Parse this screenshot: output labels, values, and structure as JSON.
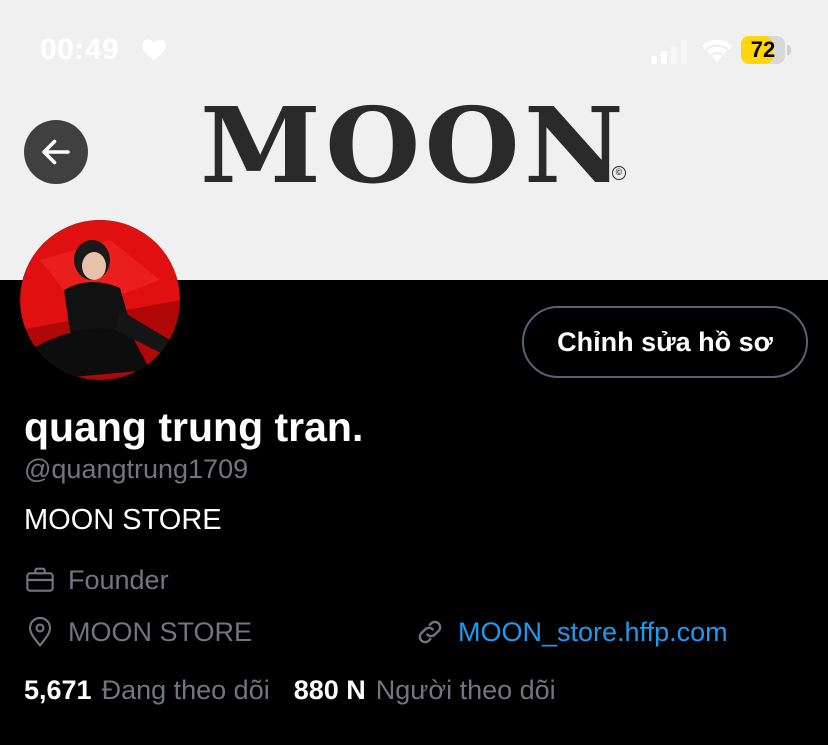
{
  "status_bar": {
    "time": "00:49",
    "battery_level": "72",
    "battery_percent": 72,
    "icons": [
      "heart-icon",
      "signal-icon",
      "wifi-icon",
      "battery-icon"
    ]
  },
  "banner": {
    "logo_text": "MOON",
    "logo_mark": "©",
    "background": "#f0f0f0"
  },
  "header": {
    "back_icon": "arrow-left-icon"
  },
  "profile": {
    "edit_button_label": "Chỉnh sửa hồ sơ",
    "display_name": "quang trung tran.",
    "handle": "@quangtrung1709",
    "bio": "MOON STORE",
    "job": "Founder",
    "location": "MOON STORE",
    "website": "MOON_store.hffp.com",
    "following_count": "5,671",
    "following_label": "Đang theo dõi",
    "followers_count": "880 N",
    "followers_label": "Người theo dõi"
  },
  "colors": {
    "background": "#000000",
    "primary_text": "#ffffff",
    "secondary_text": "#71767b",
    "link": "#1d9bf0",
    "avatar_bg": "#e01010",
    "battery": "#ffd60a"
  }
}
